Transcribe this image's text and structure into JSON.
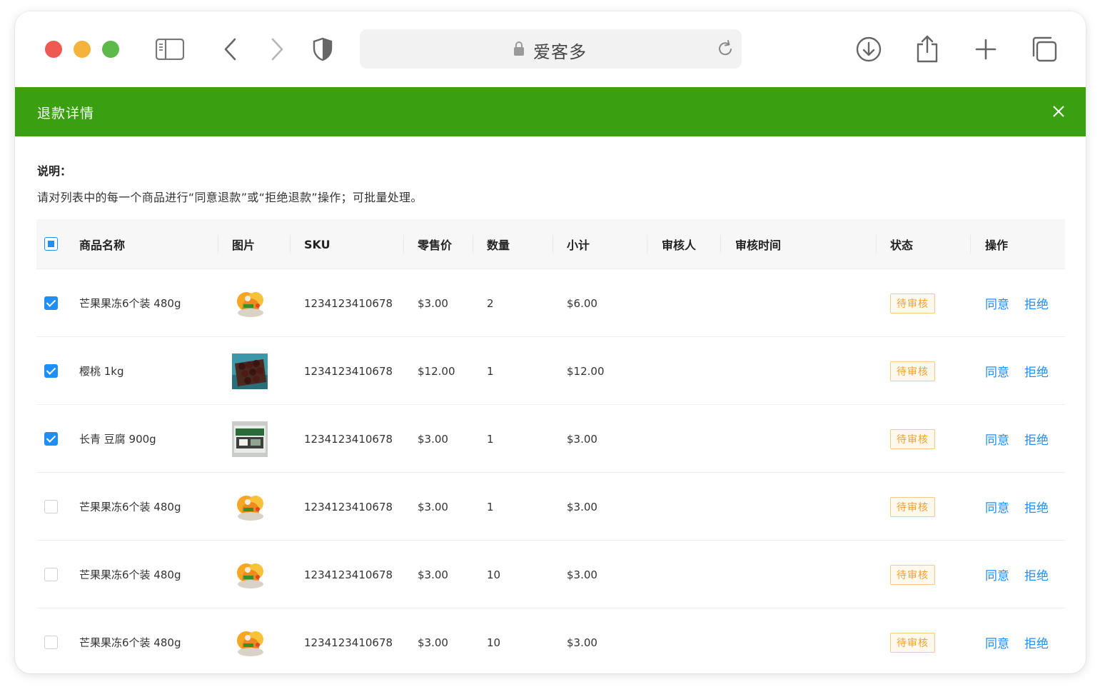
{
  "browser": {
    "site_name": "爱客多"
  },
  "modal": {
    "title": "退款详情"
  },
  "description": {
    "label": "说明：",
    "text": "请对列表中的每一个商品进行“同意退款”或“拒绝退款”操作；可批量处理。"
  },
  "table": {
    "select_all_state": "indeterminate",
    "headers": {
      "name": "商品名称",
      "image": "图片",
      "sku": "SKU",
      "price": "零售价",
      "qty": "数量",
      "subtotal": "小计",
      "reviewer": "审核人",
      "review_time": "审核时间",
      "status": "状态",
      "actions": "操作"
    },
    "rows": [
      {
        "checked": true,
        "name": "芒果果冻6个装 480g",
        "image": "mango-jelly-image",
        "sku": "1234123410678",
        "price": "$3.00",
        "qty": "2",
        "subtotal": "$6.00",
        "status": "待审核",
        "approve": "同意",
        "reject": "拒绝"
      },
      {
        "checked": true,
        "name": "樱桃 1kg",
        "image": "cherry-image",
        "sku": "1234123410678",
        "price": "$12.00",
        "qty": "1",
        "subtotal": "$12.00",
        "status": "待审核",
        "approve": "同意",
        "reject": "拒绝"
      },
      {
        "checked": true,
        "name": "长青 豆腐 900g",
        "image": "tofu-image",
        "sku": "1234123410678",
        "price": "$3.00",
        "qty": "1",
        "subtotal": "$3.00",
        "status": "待审核",
        "approve": "同意",
        "reject": "拒绝"
      },
      {
        "checked": false,
        "name": "芒果果冻6个装 480g",
        "image": "mango-jelly-image",
        "sku": "1234123410678",
        "price": "$3.00",
        "qty": "1",
        "subtotal": "$3.00",
        "status": "待审核",
        "approve": "同意",
        "reject": "拒绝"
      },
      {
        "checked": false,
        "name": "芒果果冻6个装 480g",
        "image": "mango-jelly-image",
        "sku": "1234123410678",
        "price": "$3.00",
        "qty": "10",
        "subtotal": "$3.00",
        "status": "待审核",
        "approve": "同意",
        "reject": "拒绝"
      },
      {
        "checked": false,
        "name": "芒果果冻6个装 480g",
        "image": "mango-jelly-image",
        "sku": "1234123410678",
        "price": "$3.00",
        "qty": "10",
        "subtotal": "$3.00",
        "status": "待审核",
        "approve": "同意",
        "reject": "拒绝"
      }
    ]
  },
  "colors": {
    "header_green": "#3aa011",
    "link_blue": "#1f8ef5",
    "pending_orange": "#f2a133"
  }
}
